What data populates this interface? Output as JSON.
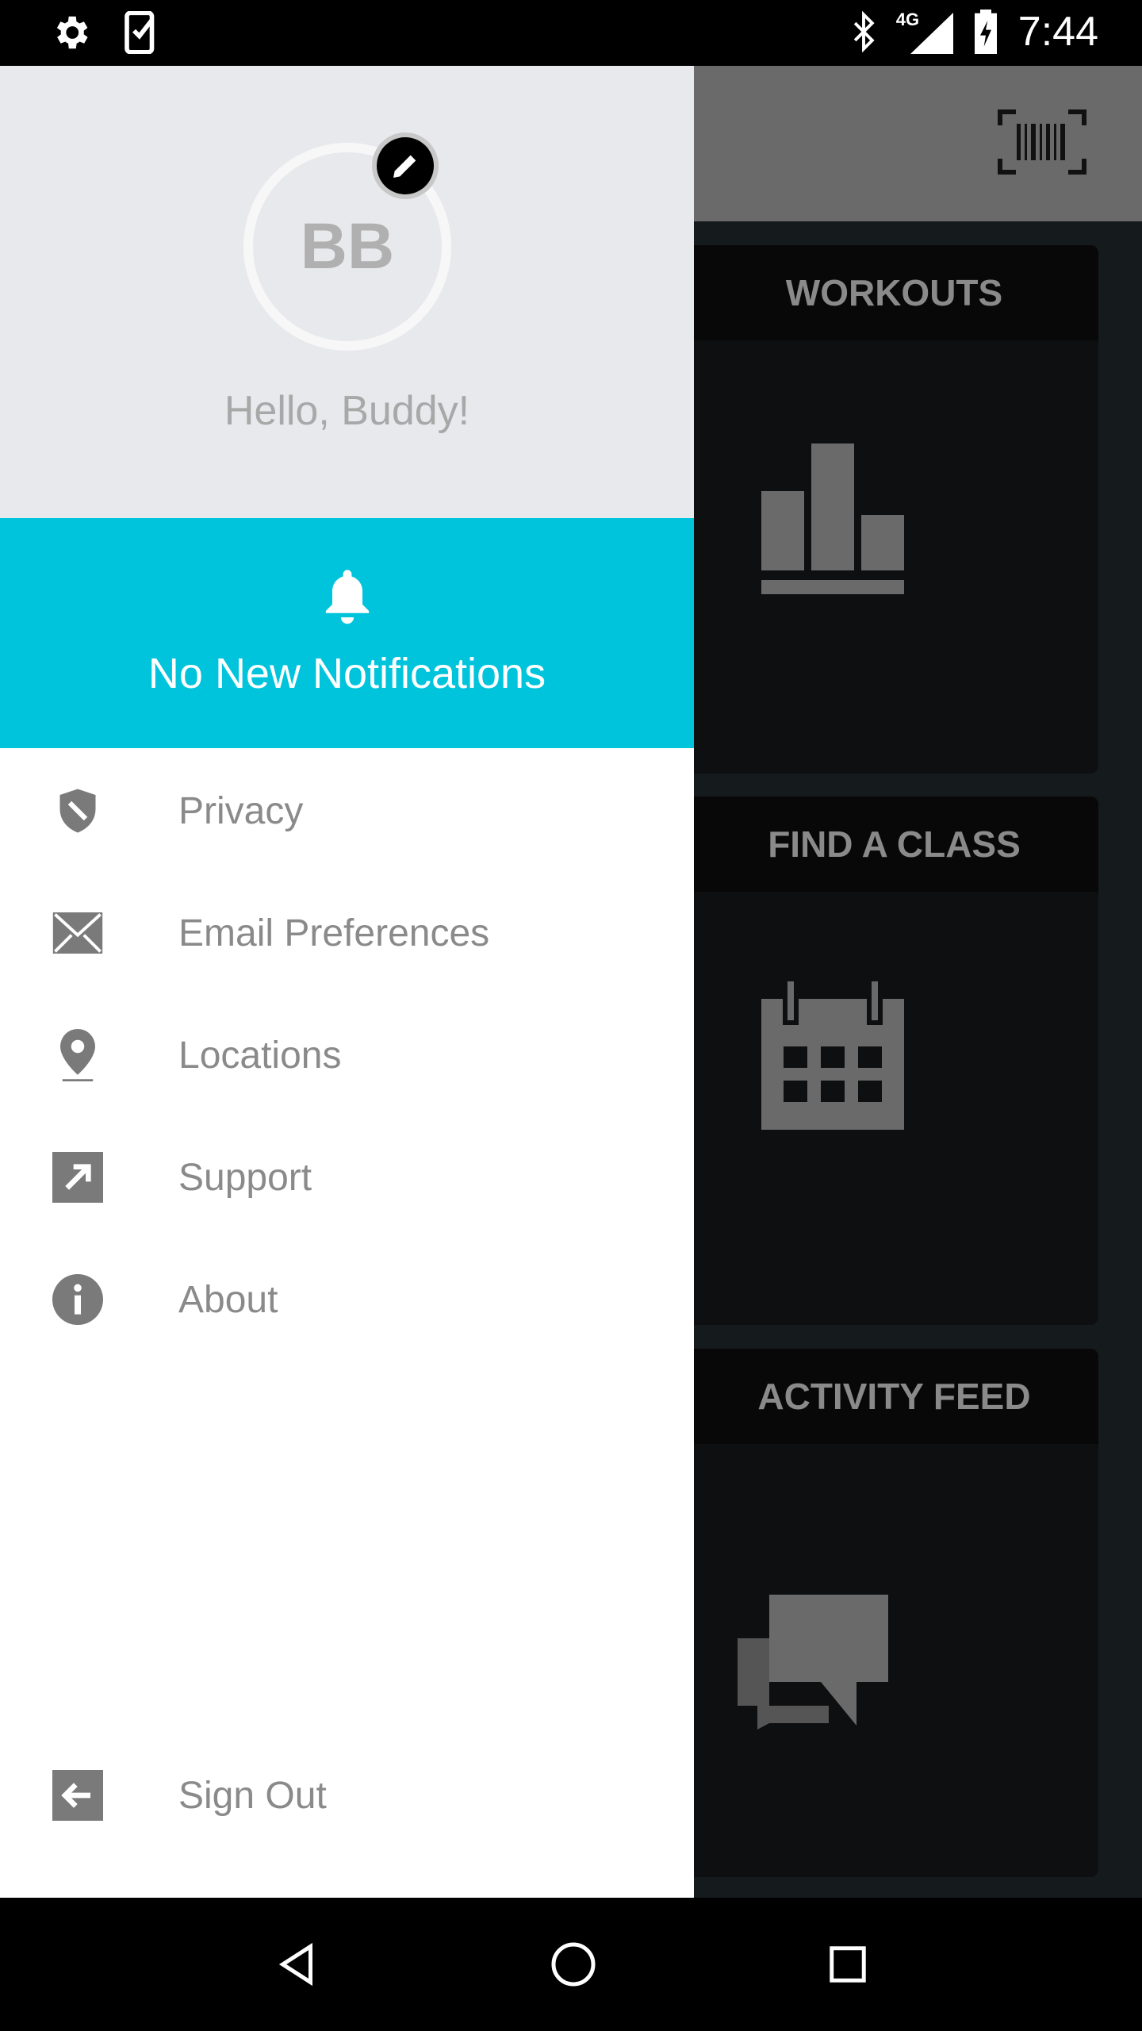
{
  "status_bar": {
    "time": "7:44",
    "network": "4G",
    "icons": [
      "gear-icon",
      "phone-check-icon",
      "bluetooth-icon",
      "signal-icon",
      "battery-charging-icon"
    ]
  },
  "toolbar": {
    "icons": [
      "barcode-scan-icon"
    ]
  },
  "cards": [
    {
      "title": "WORKOUTS",
      "icon": "bar-chart-icon"
    },
    {
      "title": "FIND A CLASS",
      "icon": "calendar-icon"
    },
    {
      "title": "ACTIVITY FEED",
      "icon": "chat-bubbles-icon"
    }
  ],
  "drawer": {
    "initials": "BB",
    "greeting": "Hello, Buddy!",
    "notification": "No New Notifications",
    "accent": "#00c4dc",
    "items": [
      {
        "label": "Privacy",
        "icon": "shield-icon"
      },
      {
        "label": "Email Preferences",
        "icon": "envelope-icon"
      },
      {
        "label": "Locations",
        "icon": "location-pin-icon"
      },
      {
        "label": "Support",
        "icon": "external-link-icon"
      },
      {
        "label": "About",
        "icon": "info-icon"
      }
    ],
    "sign_out": "Sign Out"
  },
  "nav_bar": {
    "icons": [
      "back-icon",
      "home-icon",
      "recents-icon"
    ]
  }
}
